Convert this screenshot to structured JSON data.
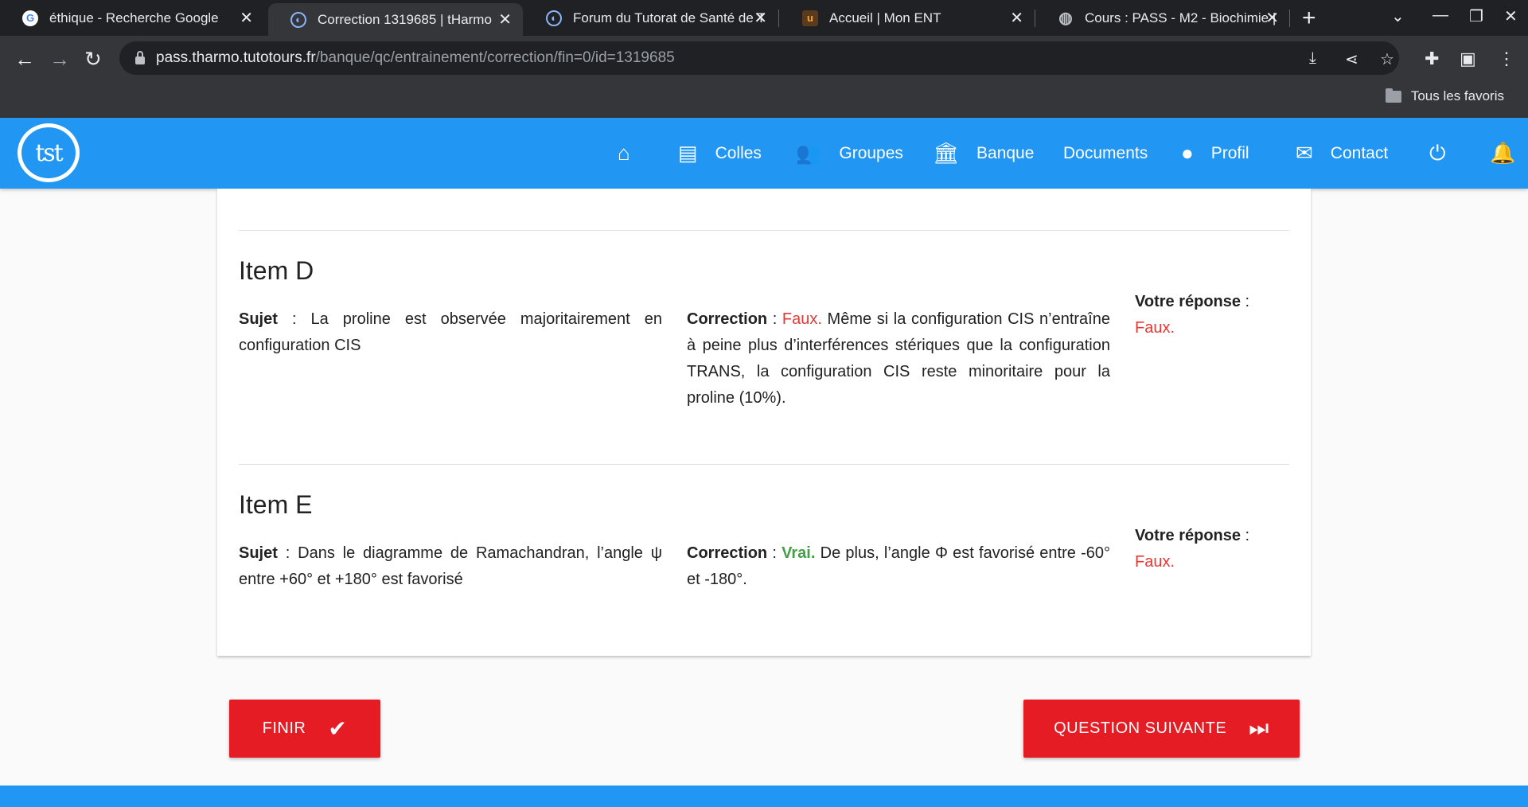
{
  "browser": {
    "tabs": [
      {
        "title": "éthique - Recherche Google",
        "favicon": "G"
      },
      {
        "title": "Correction 1319685 | tHarmo",
        "favicon": "◐"
      },
      {
        "title": "Forum du Tutorat de Santé de T",
        "favicon": "◐"
      },
      {
        "title": "Accueil | Mon ENT",
        "favicon": "u"
      },
      {
        "title": "Cours : PASS - M2 - Biochimie |",
        "favicon": "◍"
      }
    ],
    "url_host": "pass.tharmo.tutotours.fr",
    "url_path": "/banque/qc/entrainement/correction/fin=0/id=1319685",
    "bookmarks_label": "Tous les favoris"
  },
  "navbar": {
    "logo_text": "tst",
    "items": [
      "Colles",
      "Groupes",
      "Banque",
      "Documents",
      "Profil",
      "Contact"
    ]
  },
  "labels": {
    "sujet": "Sujet",
    "correction": "Correction",
    "votre_reponse": "Votre réponse",
    "sep": " : "
  },
  "items": [
    {
      "title": "Item D",
      "sujet": "La proline est observée majoritairement en configuration CIS",
      "verdict": "Faux.",
      "correction": "Même si la configuration CIS n’entraîne à peine plus d’interférences stériques que la configuration TRANS, la configuration CIS reste minoritaire pour la proline (10%).",
      "reponse": "Faux."
    },
    {
      "title": "Item E",
      "sujet": "Dans le diagramme de Ramachandran, l’angle ψ entre +60° et +180° est favorisé",
      "verdict": "Vrai.",
      "correction": "De plus, l’angle Φ est favorisé entre -60° et -180°.",
      "reponse": "Faux."
    }
  ],
  "buttons": {
    "finir": "FINIR",
    "suivante": "QUESTION SUIVANTE"
  },
  "colors": {
    "primary": "#2196f3",
    "danger": "#e51c23",
    "faux": "#e53935",
    "vrai": "#43a047"
  }
}
